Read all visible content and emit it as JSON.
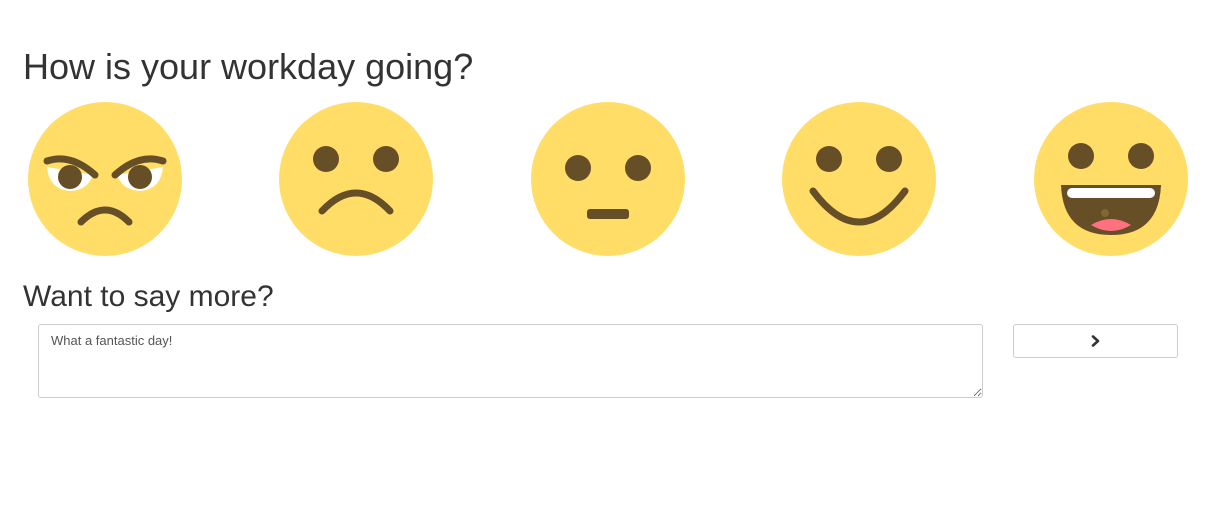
{
  "survey": {
    "question": "How is your workday going?",
    "faces": [
      {
        "mood": "angry-face-icon"
      },
      {
        "mood": "frowning-face-icon"
      },
      {
        "mood": "neutral-face-icon"
      },
      {
        "mood": "smiling-face-icon"
      },
      {
        "mood": "grinning-face-icon"
      }
    ],
    "face_color": "#ffdd67",
    "feature_color": "#664e27"
  },
  "feedback": {
    "prompt": "Want to say more?",
    "comment_value": "What a fantastic day!",
    "submit_icon": "chevron-right-icon"
  }
}
